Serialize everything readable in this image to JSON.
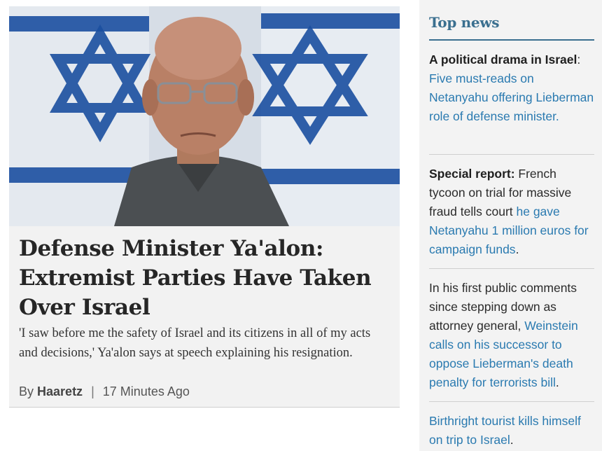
{
  "main_story": {
    "headline": "Defense Minister Ya'alon: Extremist Parties Have Taken Over Israel",
    "summary": "'I saw before me the safety of Israel and its citizens in all of my acts and decisions,' Ya'alon says at speech explaining his resignation.",
    "byline_prefix": "By",
    "author": "Haaretz",
    "separator": "|",
    "time": "17 Minutes Ago"
  },
  "sidebar": {
    "title": "Top news",
    "items": [
      {
        "lead": "A political drama in Israel",
        "lead_suffix": ":",
        "link": "Five must-reads on Netanyahu offering Lieberman role of defense minister."
      },
      {
        "lead": "Special report:",
        "text": " French tycoon on trial for massive fraud tells court ",
        "link": "he gave Netanyahu 1 million euros for campaign funds",
        "tail": "."
      },
      {
        "text": "In his first public comments since stepping down as attorney general, ",
        "link": "Weinstein calls on his successor to oppose Lieberman's death penalty for terrorists bill",
        "tail": "."
      },
      {
        "link": "Birthright tourist kills himself on trip to Israel",
        "tail": "."
      }
    ]
  },
  "colors": {
    "accent": "#3a6f8f",
    "link": "#2a7ab0",
    "flag_blue": "#1b4fa0"
  }
}
